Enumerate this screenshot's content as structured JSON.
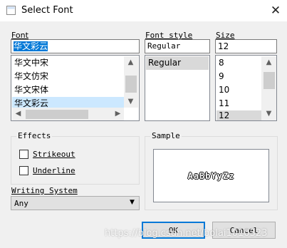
{
  "window": {
    "title": "Select Font",
    "close_icon": "close-icon"
  },
  "font": {
    "label": "Font",
    "value": "华文彩云",
    "items": [
      "华文中宋",
      "华文仿宋",
      "华文宋体",
      "华文彩云"
    ],
    "selected_index": 3
  },
  "font_style": {
    "label": "Font style",
    "value": "Regular",
    "items": [
      "Regular"
    ],
    "selected_index": 0
  },
  "size": {
    "label": "Size",
    "value": "12",
    "items": [
      "8",
      "9",
      "10",
      "11",
      "12"
    ],
    "selected_index": 4
  },
  "effects": {
    "label": "Effects",
    "strikeout_label": "Strikeout",
    "underline_label": "Underline",
    "strikeout_checked": false,
    "underline_checked": false
  },
  "writing_system": {
    "label": "Writing System",
    "value": "Any"
  },
  "sample": {
    "label": "Sample",
    "text": "AaBbYyZz"
  },
  "buttons": {
    "ok": "OK",
    "cancel": "Cancel"
  },
  "watermark": "https://blog.csdn.net/bolai1010323"
}
